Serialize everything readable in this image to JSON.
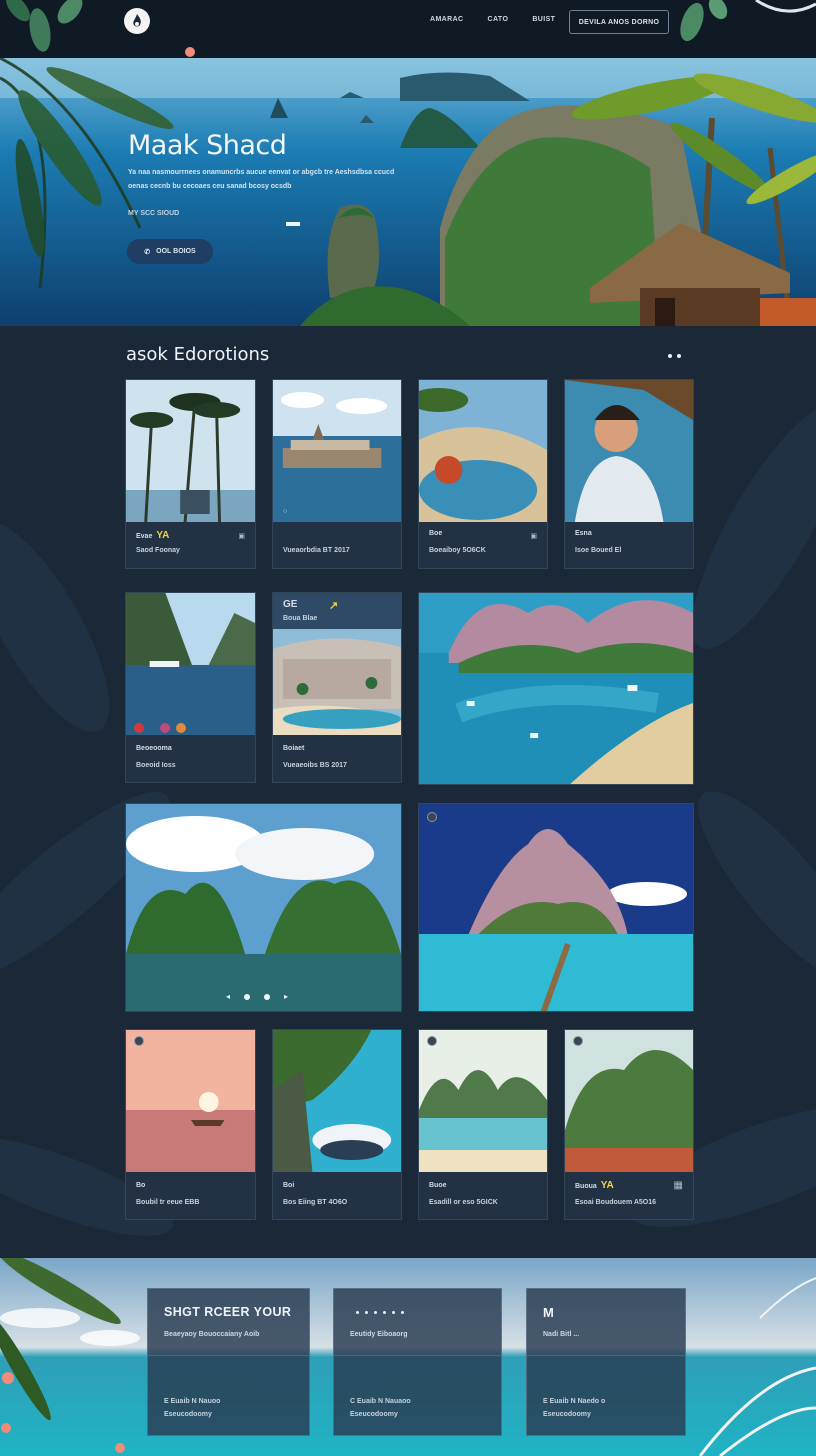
{
  "header": {
    "nav": [
      "AMARAC",
      "CATO",
      "BUIST"
    ],
    "cta": "DEVILA ANOS DORNO"
  },
  "hero": {
    "title": "Maak Shacd",
    "description": "Ya naa nasmourrnees onamuncrbs aucue eenvat or abgcb tre Aeshsdbsa ccucd oenas cecnb bu cecoaes ceu sanad bcosy ocsdb",
    "meta": "MY SCC SIOUD",
    "button": "OOL BOIOS"
  },
  "destinations": {
    "title": "asok Edorotions",
    "cards": [
      {
        "l1": "Evae",
        "badge": "YA",
        "l2": "Saod Foonay",
        "mini": "▣"
      },
      {
        "l1": "○",
        "l2": "Vueaorbdia BT 2017"
      },
      {
        "l1": "Boe",
        "mini": "▣",
        "l2": "Boeaiboy 5O6CK"
      },
      {
        "l1": "Esna",
        "l2": "Isoe Boued El"
      },
      {
        "l1": "Beoeooma",
        "l2": "Boeoid Ioss"
      },
      {
        "l1": "Boiaet",
        "l2": "Vueaeoibs BS 2017"
      },
      {
        "top1": "GE",
        "top2": "Boua Blae"
      },
      {
        "l1": "Bo",
        "l2": "Boubil tr eeue EBB"
      },
      {
        "l1": "Boi",
        "l2": "Bos Eiing BT 4O6O"
      },
      {
        "l1": "Buoe",
        "l2": "Esadill or eso 5GICK"
      },
      {
        "l1": "Buoua",
        "badge": "YA",
        "l2": "Esoai Boudouem A5O16",
        "mini": "▦"
      }
    ]
  },
  "footer": {
    "panels": [
      {
        "title": "SHGT RCEER YOUR",
        "sub": "Beaeyaoy Bouoccaiany  Aoib",
        "lines": [
          "E Euaib N Nauoo",
          "Eseucodoomy"
        ]
      },
      {
        "sub": "Eeutidy Eiboaorg",
        "lines": [
          "C Euaib N Nauaoo",
          "Eseucodoomy"
        ]
      },
      {
        "title": "M",
        "sub": "Nadi Bitl  ...",
        "lines": [
          "E Euaib N Naedo o",
          "Eseucodoomy"
        ]
      }
    ]
  }
}
